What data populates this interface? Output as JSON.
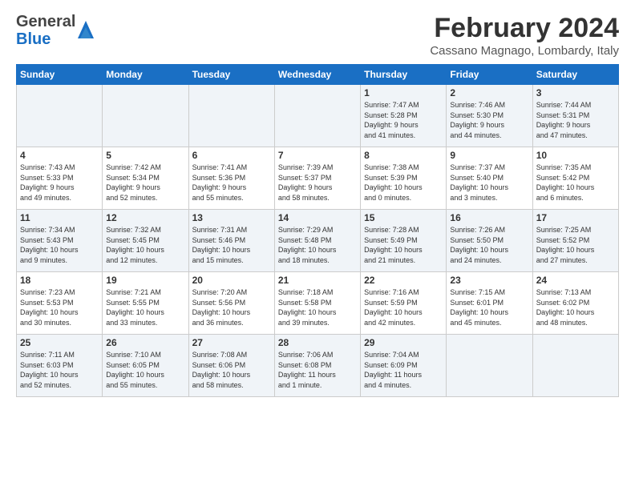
{
  "logo": {
    "line1": "General",
    "line2": "Blue"
  },
  "title": "February 2024",
  "location": "Cassano Magnago, Lombardy, Italy",
  "days": [
    "Sunday",
    "Monday",
    "Tuesday",
    "Wednesday",
    "Thursday",
    "Friday",
    "Saturday"
  ],
  "weeks": [
    [
      {
        "num": "",
        "info": ""
      },
      {
        "num": "",
        "info": ""
      },
      {
        "num": "",
        "info": ""
      },
      {
        "num": "",
        "info": ""
      },
      {
        "num": "1",
        "info": "Sunrise: 7:47 AM\nSunset: 5:28 PM\nDaylight: 9 hours\nand 41 minutes."
      },
      {
        "num": "2",
        "info": "Sunrise: 7:46 AM\nSunset: 5:30 PM\nDaylight: 9 hours\nand 44 minutes."
      },
      {
        "num": "3",
        "info": "Sunrise: 7:44 AM\nSunset: 5:31 PM\nDaylight: 9 hours\nand 47 minutes."
      }
    ],
    [
      {
        "num": "4",
        "info": "Sunrise: 7:43 AM\nSunset: 5:33 PM\nDaylight: 9 hours\nand 49 minutes."
      },
      {
        "num": "5",
        "info": "Sunrise: 7:42 AM\nSunset: 5:34 PM\nDaylight: 9 hours\nand 52 minutes."
      },
      {
        "num": "6",
        "info": "Sunrise: 7:41 AM\nSunset: 5:36 PM\nDaylight: 9 hours\nand 55 minutes."
      },
      {
        "num": "7",
        "info": "Sunrise: 7:39 AM\nSunset: 5:37 PM\nDaylight: 9 hours\nand 58 minutes."
      },
      {
        "num": "8",
        "info": "Sunrise: 7:38 AM\nSunset: 5:39 PM\nDaylight: 10 hours\nand 0 minutes."
      },
      {
        "num": "9",
        "info": "Sunrise: 7:37 AM\nSunset: 5:40 PM\nDaylight: 10 hours\nand 3 minutes."
      },
      {
        "num": "10",
        "info": "Sunrise: 7:35 AM\nSunset: 5:42 PM\nDaylight: 10 hours\nand 6 minutes."
      }
    ],
    [
      {
        "num": "11",
        "info": "Sunrise: 7:34 AM\nSunset: 5:43 PM\nDaylight: 10 hours\nand 9 minutes."
      },
      {
        "num": "12",
        "info": "Sunrise: 7:32 AM\nSunset: 5:45 PM\nDaylight: 10 hours\nand 12 minutes."
      },
      {
        "num": "13",
        "info": "Sunrise: 7:31 AM\nSunset: 5:46 PM\nDaylight: 10 hours\nand 15 minutes."
      },
      {
        "num": "14",
        "info": "Sunrise: 7:29 AM\nSunset: 5:48 PM\nDaylight: 10 hours\nand 18 minutes."
      },
      {
        "num": "15",
        "info": "Sunrise: 7:28 AM\nSunset: 5:49 PM\nDaylight: 10 hours\nand 21 minutes."
      },
      {
        "num": "16",
        "info": "Sunrise: 7:26 AM\nSunset: 5:50 PM\nDaylight: 10 hours\nand 24 minutes."
      },
      {
        "num": "17",
        "info": "Sunrise: 7:25 AM\nSunset: 5:52 PM\nDaylight: 10 hours\nand 27 minutes."
      }
    ],
    [
      {
        "num": "18",
        "info": "Sunrise: 7:23 AM\nSunset: 5:53 PM\nDaylight: 10 hours\nand 30 minutes."
      },
      {
        "num": "19",
        "info": "Sunrise: 7:21 AM\nSunset: 5:55 PM\nDaylight: 10 hours\nand 33 minutes."
      },
      {
        "num": "20",
        "info": "Sunrise: 7:20 AM\nSunset: 5:56 PM\nDaylight: 10 hours\nand 36 minutes."
      },
      {
        "num": "21",
        "info": "Sunrise: 7:18 AM\nSunset: 5:58 PM\nDaylight: 10 hours\nand 39 minutes."
      },
      {
        "num": "22",
        "info": "Sunrise: 7:16 AM\nSunset: 5:59 PM\nDaylight: 10 hours\nand 42 minutes."
      },
      {
        "num": "23",
        "info": "Sunrise: 7:15 AM\nSunset: 6:01 PM\nDaylight: 10 hours\nand 45 minutes."
      },
      {
        "num": "24",
        "info": "Sunrise: 7:13 AM\nSunset: 6:02 PM\nDaylight: 10 hours\nand 48 minutes."
      }
    ],
    [
      {
        "num": "25",
        "info": "Sunrise: 7:11 AM\nSunset: 6:03 PM\nDaylight: 10 hours\nand 52 minutes."
      },
      {
        "num": "26",
        "info": "Sunrise: 7:10 AM\nSunset: 6:05 PM\nDaylight: 10 hours\nand 55 minutes."
      },
      {
        "num": "27",
        "info": "Sunrise: 7:08 AM\nSunset: 6:06 PM\nDaylight: 10 hours\nand 58 minutes."
      },
      {
        "num": "28",
        "info": "Sunrise: 7:06 AM\nSunset: 6:08 PM\nDaylight: 11 hours\nand 1 minute."
      },
      {
        "num": "29",
        "info": "Sunrise: 7:04 AM\nSunset: 6:09 PM\nDaylight: 11 hours\nand 4 minutes."
      },
      {
        "num": "",
        "info": ""
      },
      {
        "num": "",
        "info": ""
      }
    ]
  ]
}
